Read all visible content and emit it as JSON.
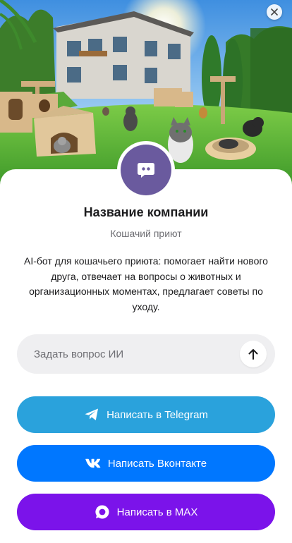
{
  "company": {
    "name": "Название компании",
    "subtitle": "Кошачий приют"
  },
  "description": "AI-бот для кошачьего приюта: помогает найти нового друга, отвечает на вопросы о животных и организационных моментах, предлагает советы по уходу.",
  "ask": {
    "placeholder": "Задать вопрос ИИ"
  },
  "buttons": {
    "telegram": "Написать в Telegram",
    "vk": "Написать Вконтакте",
    "max": "Написать в MAX"
  },
  "colors": {
    "avatar": "#6a5a9e",
    "telegram": "#2aa2dc",
    "vk": "#0077ff",
    "max": "#7b13ea"
  },
  "icons": {
    "close": "close-icon",
    "chat": "chat-bubble-icon",
    "send": "arrow-up-icon",
    "telegram": "telegram-icon",
    "vk": "vk-icon",
    "max": "max-icon"
  }
}
